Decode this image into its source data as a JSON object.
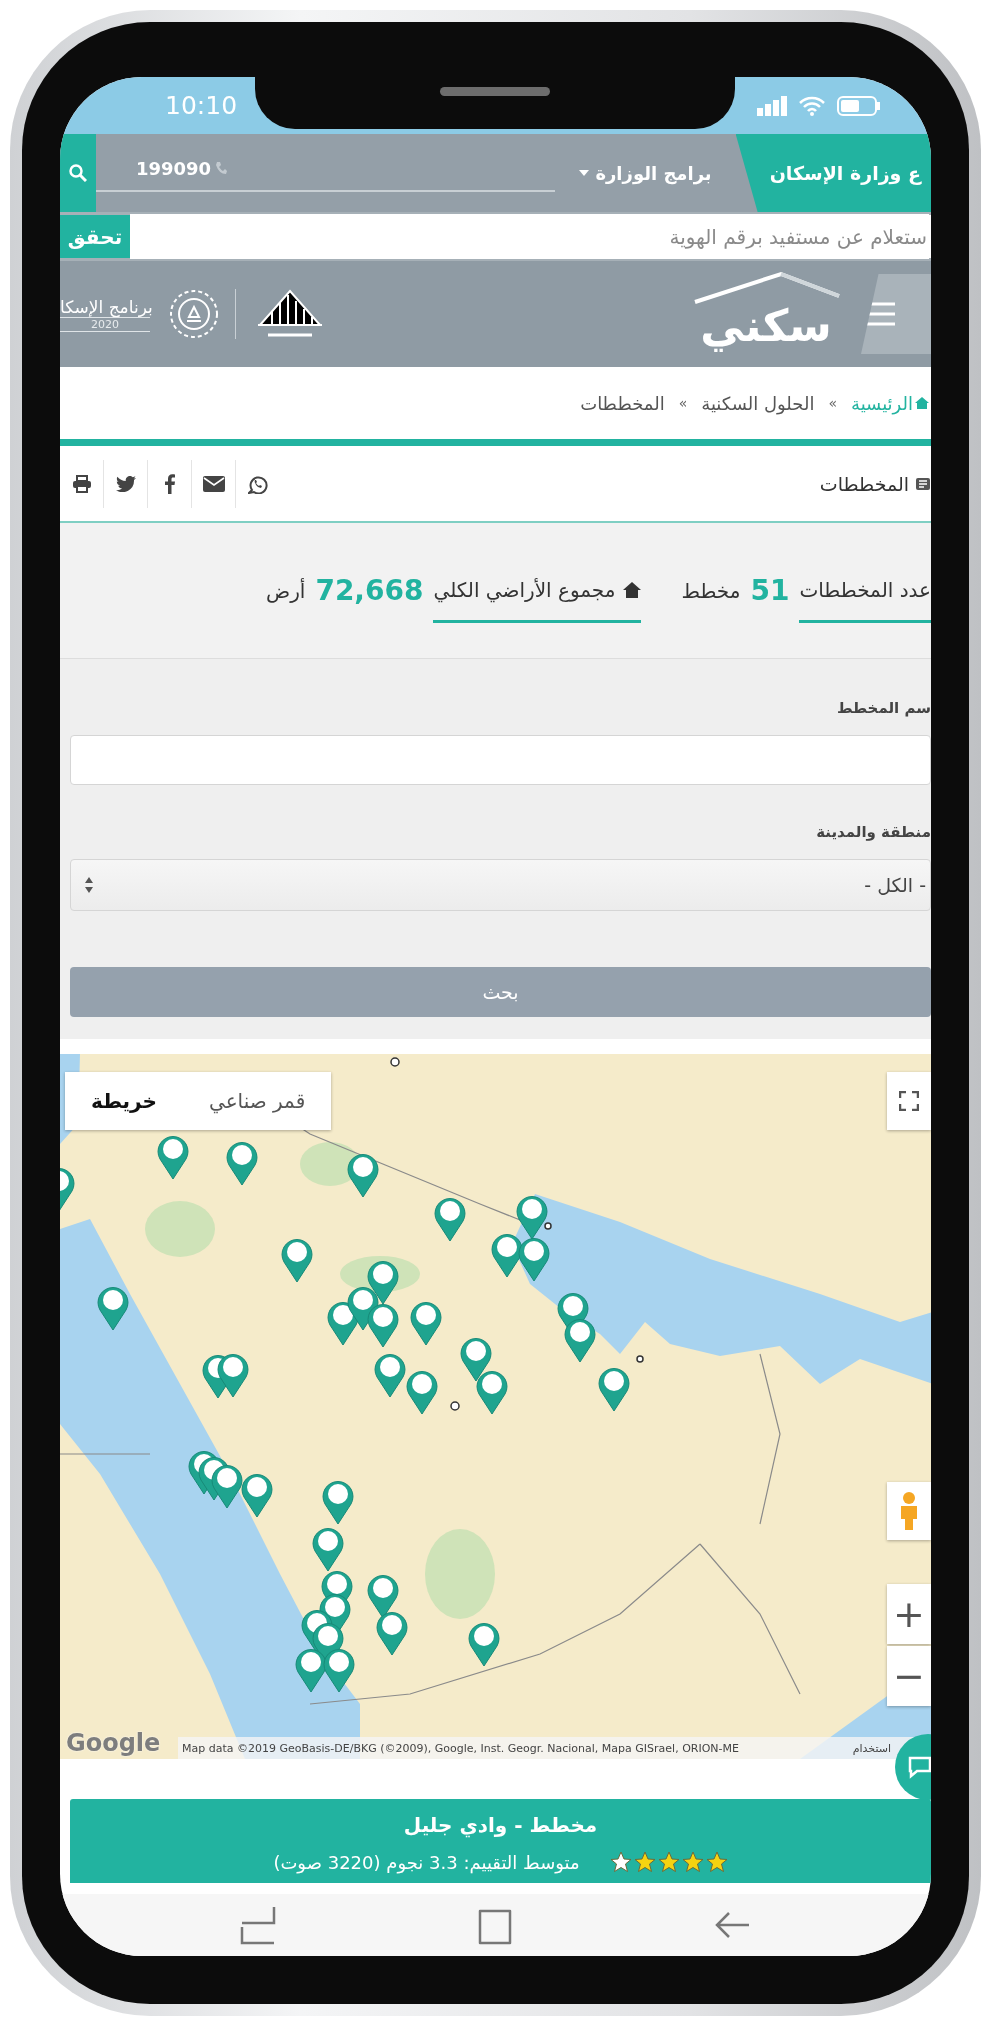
{
  "status_bar": {
    "time": "10:10"
  },
  "top_nav": {
    "ministry_tab": "ع وزارة الإسكان",
    "programs_menu": "برامج الوزارة",
    "phone": "199090"
  },
  "id_check": {
    "placeholder": "ستعلام عن مستفيد برقم الهوية",
    "button": "تحقق"
  },
  "header": {
    "logo": "سكني",
    "program_title": "برنامج الإسكا",
    "program_year": "2020"
  },
  "breadcrumb": [
    {
      "label": "الرئيسية",
      "kind": "home"
    },
    {
      "label": "»",
      "kind": "separator"
    },
    {
      "label": "الحلول السكنية",
      "kind": "page"
    },
    {
      "label": "»",
      "kind": "separator"
    },
    {
      "label": "المخططات",
      "kind": "page"
    }
  ],
  "page_title": "المخططات",
  "stats": [
    {
      "label": "عدد المخططات",
      "value": "51",
      "unit": "مخطط",
      "has_icon": false
    },
    {
      "label": "مجموع الأراضي الكلي",
      "value": "72,668",
      "unit": "أرض",
      "has_icon": true
    }
  ],
  "form": {
    "fields": [
      {
        "label": "سم المخطط",
        "kind": "text"
      },
      {
        "label": "منطقة والمدينة",
        "kind": "select",
        "value": "- الكل -"
      }
    ],
    "submit": "بحث"
  },
  "map": {
    "map_types": [
      {
        "label": "قمر صناعي",
        "selected": false
      },
      {
        "label": "خريطة",
        "selected": true
      }
    ],
    "zoom_in": "+",
    "zoom_out": "−",
    "logo": "Google",
    "attribution": "Map data ©2019 GeoBasis-DE/BKG (©2009), Google, Inst. Geogr. Nacional, Mapa GISrael, ORION-ME",
    "terms": "استخدام"
  },
  "plan_card": {
    "title": "مخطط - وادي جليل",
    "stars": 4,
    "rating": "متوسط التقييم: 3.3 نجوم (3220 صوت)"
  }
}
